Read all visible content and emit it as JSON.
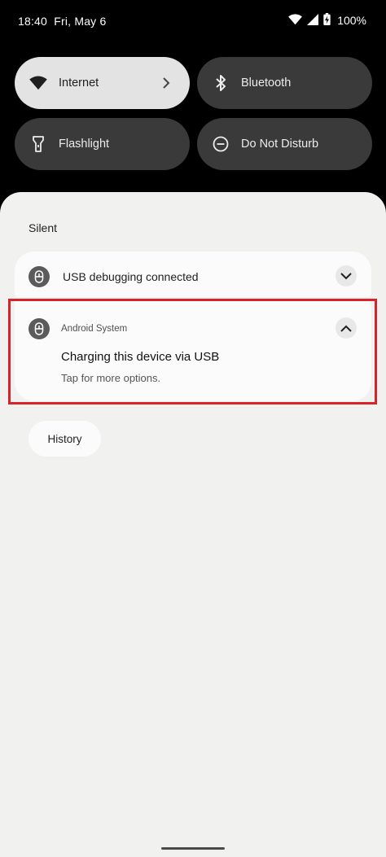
{
  "status_bar": {
    "time": "18:40",
    "date": "Fri, May 6",
    "battery": "100%",
    "icons": [
      "wifi-icon",
      "signal-icon",
      "battery-charging-icon"
    ]
  },
  "quick_settings": {
    "internet": "Internet",
    "bluetooth": "Bluetooth",
    "flashlight": "Flashlight",
    "dnd": "Do Not Disturb"
  },
  "shade": {
    "section_label": "Silent",
    "notifications": [
      {
        "title": "USB debugging connected",
        "icon": "android-system-icon",
        "expand": "chevron-down-icon"
      },
      {
        "app": "Android System",
        "title": "Charging this device via USB",
        "text": "Tap for more options.",
        "icon": "android-system-icon",
        "expand": "chevron-up-icon"
      }
    ],
    "history_label": "History"
  },
  "colors": {
    "highlight": "#d8232a",
    "active_tile": "#e3e3e3",
    "inactive_tile": "#3a3a3a",
    "shade": "#f1f1f0"
  }
}
